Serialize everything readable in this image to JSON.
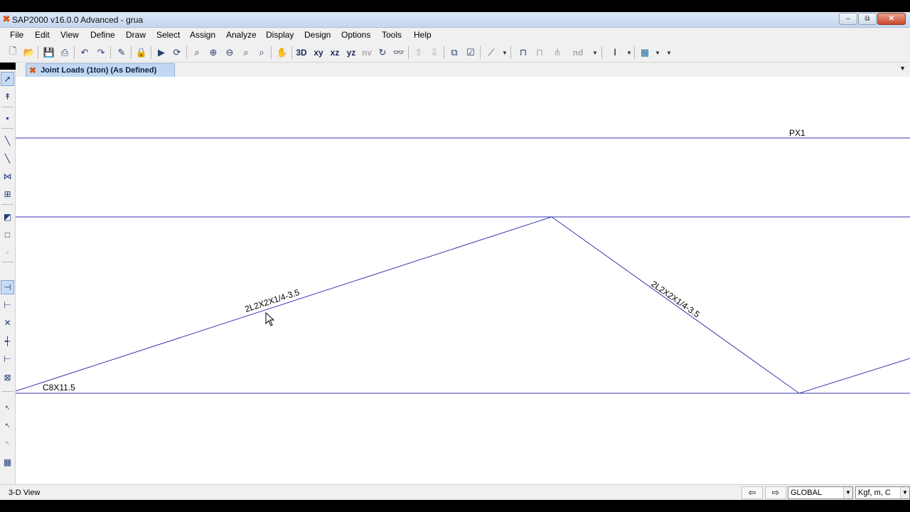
{
  "window": {
    "title": "SAP2000 v16.0.0 Advanced  - grua",
    "minimize": "–",
    "restore": "⧉",
    "close": "✕"
  },
  "menu": [
    "File",
    "Edit",
    "View",
    "Define",
    "Draw",
    "Select",
    "Assign",
    "Analyze",
    "Display",
    "Design",
    "Options",
    "Tools",
    "Help"
  ],
  "toolbar": {
    "view_xy": "xy",
    "view_xz": "xz",
    "view_yz": "yz",
    "view_nv": "nv",
    "view_3d": "3D",
    "nd": "nd"
  },
  "tab": {
    "label": "Joint Loads (1ton) (As Defined)"
  },
  "canvas": {
    "labels": {
      "top_chord": "PX1",
      "diagonal_left": "2L2X2X1/4-3.5",
      "diagonal_right": "2L2X2X1/4-3.5",
      "bottom_chord": "C8X11.5"
    },
    "line_color": "#3636b0"
  },
  "status": {
    "view_name": "3-D View",
    "coord_system": "GLOBAL",
    "units": "Kgf, m, C"
  },
  "colors": {
    "accent": "#d75a16",
    "tab_bg": "#c2d8f1",
    "chrome": "#f0f0f0"
  }
}
